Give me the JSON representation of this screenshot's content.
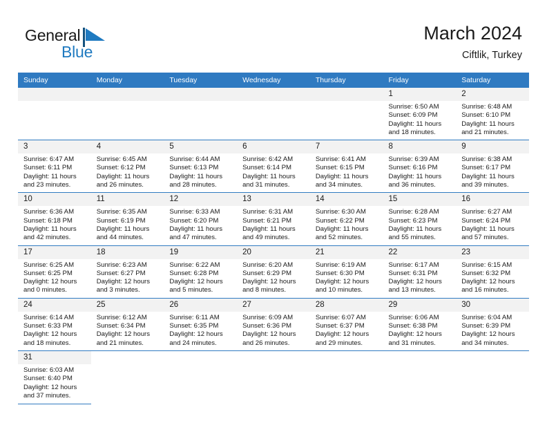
{
  "brand": {
    "name_part1": "General",
    "name_part2": "Blue",
    "accent_color": "#1f7ac0",
    "flag_icon": "general-blue-flag-logo"
  },
  "header": {
    "title": "March 2024",
    "subtitle": "Ciftlik, Turkey"
  },
  "theme": {
    "header_blue": "#2f7ac1",
    "daynum_band": "#f2f2f2",
    "text": "#1a1a1a"
  },
  "weekday_headers": [
    "Sunday",
    "Monday",
    "Tuesday",
    "Wednesday",
    "Thursday",
    "Friday",
    "Saturday"
  ],
  "weeks": [
    [
      {
        "day": "",
        "empty": true
      },
      {
        "day": "",
        "empty": true
      },
      {
        "day": "",
        "empty": true
      },
      {
        "day": "",
        "empty": true
      },
      {
        "day": "",
        "empty": true
      },
      {
        "day": "1",
        "sunrise": "Sunrise: 6:50 AM",
        "sunset": "Sunset: 6:09 PM",
        "daylight1": "Daylight: 11 hours",
        "daylight2": "and 18 minutes."
      },
      {
        "day": "2",
        "sunrise": "Sunrise: 6:48 AM",
        "sunset": "Sunset: 6:10 PM",
        "daylight1": "Daylight: 11 hours",
        "daylight2": "and 21 minutes."
      }
    ],
    [
      {
        "day": "3",
        "sunrise": "Sunrise: 6:47 AM",
        "sunset": "Sunset: 6:11 PM",
        "daylight1": "Daylight: 11 hours",
        "daylight2": "and 23 minutes."
      },
      {
        "day": "4",
        "sunrise": "Sunrise: 6:45 AM",
        "sunset": "Sunset: 6:12 PM",
        "daylight1": "Daylight: 11 hours",
        "daylight2": "and 26 minutes."
      },
      {
        "day": "5",
        "sunrise": "Sunrise: 6:44 AM",
        "sunset": "Sunset: 6:13 PM",
        "daylight1": "Daylight: 11 hours",
        "daylight2": "and 28 minutes."
      },
      {
        "day": "6",
        "sunrise": "Sunrise: 6:42 AM",
        "sunset": "Sunset: 6:14 PM",
        "daylight1": "Daylight: 11 hours",
        "daylight2": "and 31 minutes."
      },
      {
        "day": "7",
        "sunrise": "Sunrise: 6:41 AM",
        "sunset": "Sunset: 6:15 PM",
        "daylight1": "Daylight: 11 hours",
        "daylight2": "and 34 minutes."
      },
      {
        "day": "8",
        "sunrise": "Sunrise: 6:39 AM",
        "sunset": "Sunset: 6:16 PM",
        "daylight1": "Daylight: 11 hours",
        "daylight2": "and 36 minutes."
      },
      {
        "day": "9",
        "sunrise": "Sunrise: 6:38 AM",
        "sunset": "Sunset: 6:17 PM",
        "daylight1": "Daylight: 11 hours",
        "daylight2": "and 39 minutes."
      }
    ],
    [
      {
        "day": "10",
        "sunrise": "Sunrise: 6:36 AM",
        "sunset": "Sunset: 6:18 PM",
        "daylight1": "Daylight: 11 hours",
        "daylight2": "and 42 minutes."
      },
      {
        "day": "11",
        "sunrise": "Sunrise: 6:35 AM",
        "sunset": "Sunset: 6:19 PM",
        "daylight1": "Daylight: 11 hours",
        "daylight2": "and 44 minutes."
      },
      {
        "day": "12",
        "sunrise": "Sunrise: 6:33 AM",
        "sunset": "Sunset: 6:20 PM",
        "daylight1": "Daylight: 11 hours",
        "daylight2": "and 47 minutes."
      },
      {
        "day": "13",
        "sunrise": "Sunrise: 6:31 AM",
        "sunset": "Sunset: 6:21 PM",
        "daylight1": "Daylight: 11 hours",
        "daylight2": "and 49 minutes."
      },
      {
        "day": "14",
        "sunrise": "Sunrise: 6:30 AM",
        "sunset": "Sunset: 6:22 PM",
        "daylight1": "Daylight: 11 hours",
        "daylight2": "and 52 minutes."
      },
      {
        "day": "15",
        "sunrise": "Sunrise: 6:28 AM",
        "sunset": "Sunset: 6:23 PM",
        "daylight1": "Daylight: 11 hours",
        "daylight2": "and 55 minutes."
      },
      {
        "day": "16",
        "sunrise": "Sunrise: 6:27 AM",
        "sunset": "Sunset: 6:24 PM",
        "daylight1": "Daylight: 11 hours",
        "daylight2": "and 57 minutes."
      }
    ],
    [
      {
        "day": "17",
        "sunrise": "Sunrise: 6:25 AM",
        "sunset": "Sunset: 6:25 PM",
        "daylight1": "Daylight: 12 hours",
        "daylight2": "and 0 minutes."
      },
      {
        "day": "18",
        "sunrise": "Sunrise: 6:23 AM",
        "sunset": "Sunset: 6:27 PM",
        "daylight1": "Daylight: 12 hours",
        "daylight2": "and 3 minutes."
      },
      {
        "day": "19",
        "sunrise": "Sunrise: 6:22 AM",
        "sunset": "Sunset: 6:28 PM",
        "daylight1": "Daylight: 12 hours",
        "daylight2": "and 5 minutes."
      },
      {
        "day": "20",
        "sunrise": "Sunrise: 6:20 AM",
        "sunset": "Sunset: 6:29 PM",
        "daylight1": "Daylight: 12 hours",
        "daylight2": "and 8 minutes."
      },
      {
        "day": "21",
        "sunrise": "Sunrise: 6:19 AM",
        "sunset": "Sunset: 6:30 PM",
        "daylight1": "Daylight: 12 hours",
        "daylight2": "and 10 minutes."
      },
      {
        "day": "22",
        "sunrise": "Sunrise: 6:17 AM",
        "sunset": "Sunset: 6:31 PM",
        "daylight1": "Daylight: 12 hours",
        "daylight2": "and 13 minutes."
      },
      {
        "day": "23",
        "sunrise": "Sunrise: 6:15 AM",
        "sunset": "Sunset: 6:32 PM",
        "daylight1": "Daylight: 12 hours",
        "daylight2": "and 16 minutes."
      }
    ],
    [
      {
        "day": "24",
        "sunrise": "Sunrise: 6:14 AM",
        "sunset": "Sunset: 6:33 PM",
        "daylight1": "Daylight: 12 hours",
        "daylight2": "and 18 minutes."
      },
      {
        "day": "25",
        "sunrise": "Sunrise: 6:12 AM",
        "sunset": "Sunset: 6:34 PM",
        "daylight1": "Daylight: 12 hours",
        "daylight2": "and 21 minutes."
      },
      {
        "day": "26",
        "sunrise": "Sunrise: 6:11 AM",
        "sunset": "Sunset: 6:35 PM",
        "daylight1": "Daylight: 12 hours",
        "daylight2": "and 24 minutes."
      },
      {
        "day": "27",
        "sunrise": "Sunrise: 6:09 AM",
        "sunset": "Sunset: 6:36 PM",
        "daylight1": "Daylight: 12 hours",
        "daylight2": "and 26 minutes."
      },
      {
        "day": "28",
        "sunrise": "Sunrise: 6:07 AM",
        "sunset": "Sunset: 6:37 PM",
        "daylight1": "Daylight: 12 hours",
        "daylight2": "and 29 minutes."
      },
      {
        "day": "29",
        "sunrise": "Sunrise: 6:06 AM",
        "sunset": "Sunset: 6:38 PM",
        "daylight1": "Daylight: 12 hours",
        "daylight2": "and 31 minutes."
      },
      {
        "day": "30",
        "sunrise": "Sunrise: 6:04 AM",
        "sunset": "Sunset: 6:39 PM",
        "daylight1": "Daylight: 12 hours",
        "daylight2": "and 34 minutes."
      }
    ],
    [
      {
        "day": "31",
        "sunrise": "Sunrise: 6:03 AM",
        "sunset": "Sunset: 6:40 PM",
        "daylight1": "Daylight: 12 hours",
        "daylight2": "and 37 minutes."
      },
      {
        "day": "",
        "blank": true
      },
      {
        "day": "",
        "blank": true
      },
      {
        "day": "",
        "blank": true
      },
      {
        "day": "",
        "blank": true
      },
      {
        "day": "",
        "blank": true
      },
      {
        "day": "",
        "blank": true
      }
    ]
  ]
}
